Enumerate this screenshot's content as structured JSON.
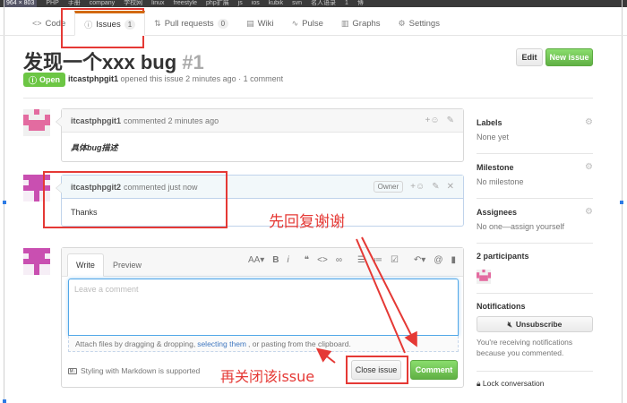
{
  "bookmarks": [
    "964 × 803",
    "PHP",
    "手册",
    "company",
    "学校网",
    "linux",
    "freestyle",
    "php扩展",
    "js",
    "ios",
    "kubik",
    "svn",
    "名人语录",
    "1",
    "博"
  ],
  "nav": {
    "tabs": [
      {
        "label": "Code",
        "icon": "code-icon",
        "glyph": "<>"
      },
      {
        "label": "Issues",
        "icon": "issue-icon",
        "glyph": "ⓘ",
        "count": "1",
        "active": true
      },
      {
        "label": "Pull requests",
        "icon": "pull-request-icon",
        "glyph": "⇅",
        "count": "0"
      },
      {
        "label": "Wiki",
        "icon": "wiki-icon",
        "glyph": "▤"
      },
      {
        "label": "Pulse",
        "icon": "pulse-icon",
        "glyph": "∿"
      },
      {
        "label": "Graphs",
        "icon": "graph-icon",
        "glyph": "▥"
      },
      {
        "label": "Settings",
        "icon": "gear-icon",
        "glyph": "⚙"
      }
    ]
  },
  "issue": {
    "title": "发现一个xxx bug",
    "number": "#1",
    "edit_label": "Edit",
    "new_issue_label": "New issue",
    "state": "Open",
    "author": "itcastphpgit1",
    "opened_text": "opened this issue 2 minutes ago · 1 comment"
  },
  "comments": [
    {
      "author": "itcastphpgit1",
      "time": "commented 2 minutes ago",
      "body": "具体bug描述",
      "owner_badge": ""
    },
    {
      "author": "itcastphpgit2",
      "time": "commented just now",
      "body": "Thanks",
      "owner_badge": "Owner"
    }
  ],
  "form": {
    "tab_write": "Write",
    "tab_preview": "Preview",
    "placeholder": "Leave a comment",
    "attach_before": "Attach files by dragging & dropping, ",
    "attach_link": "selecting them",
    "attach_after": ", or pasting from the clipboard.",
    "markdown_note": "Styling with Markdown is supported",
    "close_label": "Close issue",
    "comment_label": "Comment"
  },
  "sidebar": {
    "labels_title": "Labels",
    "labels_value": "None yet",
    "milestone_title": "Milestone",
    "milestone_value": "No milestone",
    "assignees_title": "Assignees",
    "assignees_value": "No one—assign yourself",
    "participants": "2 participants",
    "notifications_title": "Notifications",
    "unsubscribe_label": "Unsubscribe",
    "notify_note": "You're receiving notifications because you commented.",
    "lock_label": "Lock conversation"
  },
  "annotations": {
    "reply_note": "先回复谢谢",
    "close_note": "再关闭该issue"
  },
  "colors": {
    "accent_green": "#6cc644",
    "annotation_red": "#e53935",
    "link_blue": "#4078c0"
  }
}
